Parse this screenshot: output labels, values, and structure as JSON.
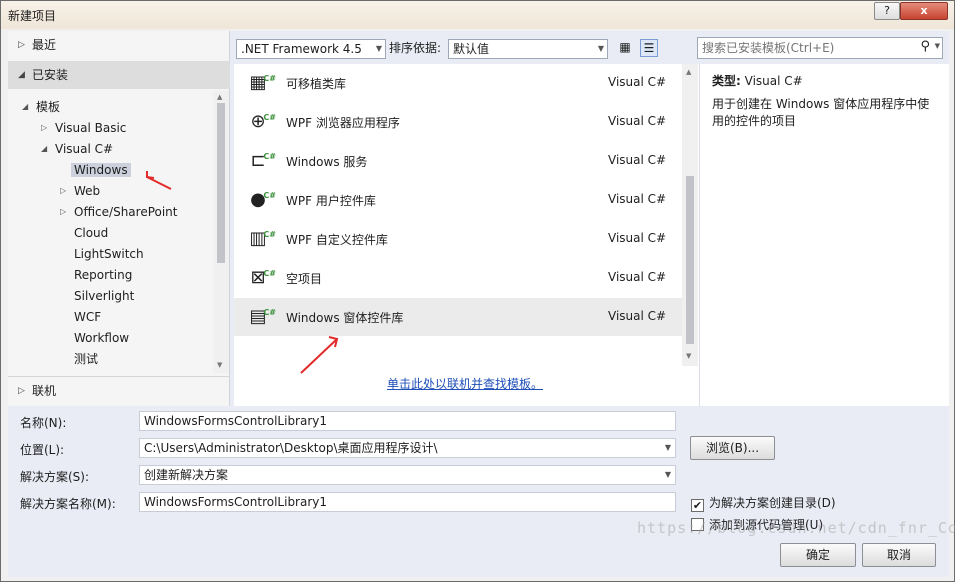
{
  "window": {
    "title": "新建项目",
    "help": "?",
    "close": "x"
  },
  "left": {
    "recent": "最近",
    "installed": "已安装",
    "online": "联机",
    "tree": [
      {
        "label": "模板",
        "toggle": "◢"
      },
      {
        "label": "Visual Basic",
        "toggle": "▷"
      },
      {
        "label": "Visual C#",
        "toggle": "◢"
      },
      {
        "label": "Windows",
        "toggle": ""
      },
      {
        "label": "Web",
        "toggle": "▷"
      },
      {
        "label": "Office/SharePoint",
        "toggle": "▷"
      },
      {
        "label": "Cloud",
        "toggle": ""
      },
      {
        "label": "LightSwitch",
        "toggle": ""
      },
      {
        "label": "Reporting",
        "toggle": ""
      },
      {
        "label": "Silverlight",
        "toggle": ""
      },
      {
        "label": "WCF",
        "toggle": ""
      },
      {
        "label": "Workflow",
        "toggle": ""
      },
      {
        "label": "测试",
        "toggle": ""
      }
    ]
  },
  "toolbar": {
    "framework": ".NET Framework 4.5",
    "sort_label": "排序依据:",
    "sort_value": "默认值"
  },
  "templates": [
    {
      "name": "可移植类库",
      "lang": "Visual C#",
      "icon": "portable-class-library-icon"
    },
    {
      "name": "WPF 浏览器应用程序",
      "lang": "Visual C#",
      "icon": "wpf-browser-app-icon"
    },
    {
      "name": "Windows 服务",
      "lang": "Visual C#",
      "icon": "windows-service-icon"
    },
    {
      "name": "WPF 用户控件库",
      "lang": "Visual C#",
      "icon": "wpf-user-control-icon"
    },
    {
      "name": "WPF 自定义控件库",
      "lang": "Visual C#",
      "icon": "wpf-custom-control-icon"
    },
    {
      "name": "空项目",
      "lang": "Visual C#",
      "icon": "empty-project-icon"
    },
    {
      "name": "Windows 窗体控件库",
      "lang": "Visual C#",
      "icon": "winforms-control-library-icon"
    }
  ],
  "online_link": "单击此处以联机并查找模板。",
  "search": {
    "placeholder": "搜索已安装模板(Ctrl+E)"
  },
  "description": {
    "type_label": "类型:",
    "type_value": "Visual C#",
    "text": "用于创建在 Windows 窗体应用程序中使用的控件的项目"
  },
  "form": {
    "name_label": "名称(N):",
    "name_value": "WindowsFormsControlLibrary1",
    "location_label": "位置(L):",
    "location_value": "C:\\Users\\Administrator\\Desktop\\桌面应用程序设计\\",
    "solution_label": "解决方案(S):",
    "solution_value": "创建新解决方案",
    "solution_name_label": "解决方案名称(M):",
    "solution_name_value": "WindowsFormsControlLibrary1",
    "browse": "浏览(B)...",
    "create_dir": "为解决方案创建目录(D)",
    "create_dir_checked": "✔",
    "add_source_control": "添加到源代码管理(U)",
    "ok": "确定",
    "cancel": "取消"
  },
  "watermark": "https://blog.csdn.net/cdn_fnr_Conner"
}
